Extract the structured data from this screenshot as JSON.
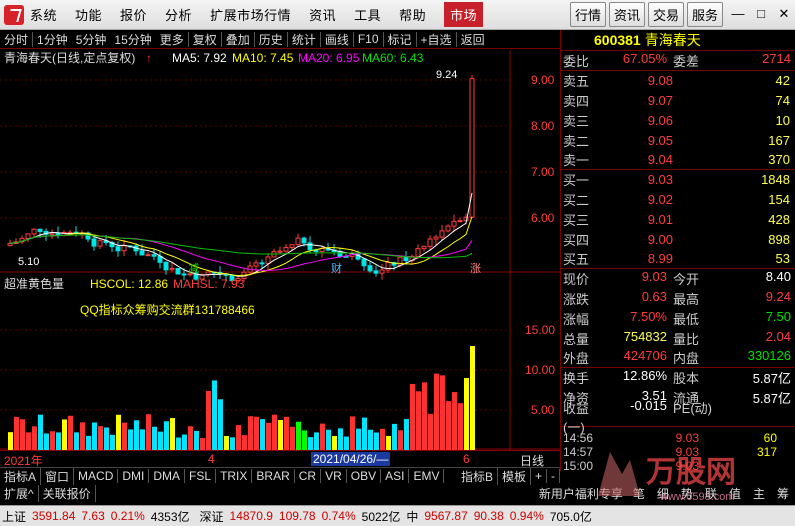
{
  "menu": {
    "items": [
      "系统",
      "功能",
      "报价",
      "分析",
      "扩展市场行情",
      "资讯",
      "工具",
      "帮助"
    ],
    "active": "市场",
    "right": [
      "行情",
      "资讯",
      "交易",
      "服务"
    ]
  },
  "toolbar": [
    "分时",
    "1分钟",
    "5分钟",
    "15分钟",
    "更多",
    "复权",
    "叠加",
    "历史",
    "统计",
    "画线",
    "F10",
    "标记",
    "+自选",
    "返回"
  ],
  "main": {
    "title": "青海春天(日线,定点复权)",
    "ma5": "MA5: 7.92",
    "ma10": "MA10: 7.45",
    "ma20": "MA20: 6.95",
    "ma60": "MA60: 6.43",
    "high_label": "9.24",
    "low_label": "5.10",
    "y_ticks": [
      "9.00",
      "8.00",
      "7.00",
      "6.00"
    ],
    "events": [
      "减",
      "财",
      "涨"
    ]
  },
  "vol": {
    "title": "超准黄色量",
    "hscol": "HSCOL: 12.86",
    "mahsl": "MAHSL: 7.93",
    "ad": "QQ指标众筹购交流群131788466",
    "y_ticks": [
      "15.00",
      "10.00",
      "5.00"
    ]
  },
  "date_axis": {
    "left": "2021年",
    "m4": "4",
    "sel": "2021/04/26/—",
    "m6": "6",
    "period": "日线"
  },
  "stock": {
    "code": "600381",
    "name": "青海春天"
  },
  "quote": {
    "wb_l": "委比",
    "wb": "67.05%",
    "wc_l": "委差",
    "wc": "2714",
    "sells": [
      [
        "卖五",
        "9.08",
        "42"
      ],
      [
        "卖四",
        "9.07",
        "74"
      ],
      [
        "卖三",
        "9.06",
        "10"
      ],
      [
        "卖二",
        "9.05",
        "167"
      ],
      [
        "卖一",
        "9.04",
        "370"
      ]
    ],
    "buys": [
      [
        "买一",
        "9.03",
        "1848"
      ],
      [
        "买二",
        "9.02",
        "154"
      ],
      [
        "买三",
        "9.01",
        "428"
      ],
      [
        "买四",
        "9.00",
        "898"
      ],
      [
        "买五",
        "8.99",
        "53"
      ]
    ],
    "stats": [
      [
        "现价",
        "9.03",
        "今开",
        "8.40"
      ],
      [
        "涨跌",
        "0.63",
        "最高",
        "9.24"
      ],
      [
        "涨幅",
        "7.50%",
        "最低",
        "7.50"
      ],
      [
        "总量",
        "754832",
        "量比",
        "2.04"
      ],
      [
        "外盘",
        "424706",
        "内盘",
        "330126"
      ]
    ],
    "stats2": [
      [
        "换手",
        "12.86%",
        "股本",
        "5.87亿"
      ],
      [
        "净资",
        "3.51",
        "流通",
        "5.87亿"
      ],
      [
        "收益(一)",
        "-0.015",
        "PE(动)",
        ""
      ]
    ],
    "ticks": [
      [
        "14:56",
        "9.03",
        "60"
      ],
      [
        "14:57",
        "9.03",
        "317"
      ],
      [
        "15:00",
        "9.03",
        ""
      ]
    ]
  },
  "tabs1": [
    "指标A",
    "窗口",
    "MACD",
    "DMI",
    "DMA",
    "FSL",
    "TRIX",
    "BRAR",
    "CR",
    "VR",
    "OBV",
    "ASI",
    "EMV",
    "指标B",
    "模板",
    "+",
    "-"
  ],
  "tabs2_left": [
    "扩展^",
    "关联报价"
  ],
  "tabs2_right": [
    "新用户福利专享",
    "笔",
    "细",
    "势",
    "联",
    "值",
    "主",
    "筹"
  ],
  "status": {
    "sh_l": "上证",
    "sh": "3591.84",
    "sh_c": "7.63",
    "sh_p": "0.21%",
    "sh_a": "4353亿",
    "sz_l": "深证",
    "sz": "14870.9",
    "sz_c": "109.78",
    "sz_p": "0.74%",
    "sz_a": "5022亿",
    "cy_l": "中",
    "cy": "9567.87",
    "cy_c": "90.38",
    "cy_p": "0.94%",
    "cy_a": "705.0亿"
  },
  "watermark": "万股网",
  "watermark_url": "www.0598.com"
}
